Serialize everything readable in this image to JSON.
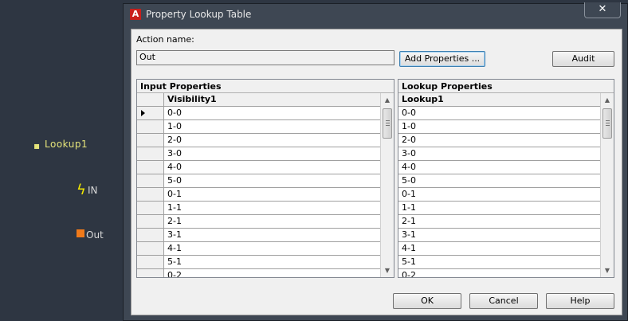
{
  "canvas": {
    "lookup_label": "Lookup1",
    "in_label": "IN",
    "out_label": "Out"
  },
  "dialog": {
    "title": "Property Lookup Table",
    "app_icon_letter": "A",
    "close_glyph": "✕",
    "action_name_label": "Action name:",
    "action_name_value": "Out",
    "add_properties_label": "Add Properties ...",
    "audit_label": "Audit",
    "ok_label": "OK",
    "cancel_label": "Cancel",
    "help_label": "Help"
  },
  "input_properties": {
    "title": "Input Properties",
    "column": "Visibility1",
    "rows": [
      "0-0",
      "1-0",
      "2-0",
      "3-0",
      "4-0",
      "5-0",
      "0-1",
      "1-1",
      "2-1",
      "3-1",
      "4-1",
      "5-1",
      "0-2"
    ]
  },
  "lookup_properties": {
    "title": "Lookup Properties",
    "column": "Lookup1",
    "rows": [
      "0-0",
      "1-0",
      "2-0",
      "3-0",
      "4-0",
      "5-0",
      "0-1",
      "1-1",
      "2-1",
      "3-1",
      "4-1",
      "5-1",
      "0-2"
    ]
  },
  "icons": {
    "in_icon": "lightning-icon",
    "out_icon": "orange-square-grip-icon"
  },
  "colors": {
    "canvas_bg": "#2e3642",
    "lookup_text": "#e5e47a",
    "lightning": "#f2e800",
    "out_grip": "#f07a1a"
  }
}
